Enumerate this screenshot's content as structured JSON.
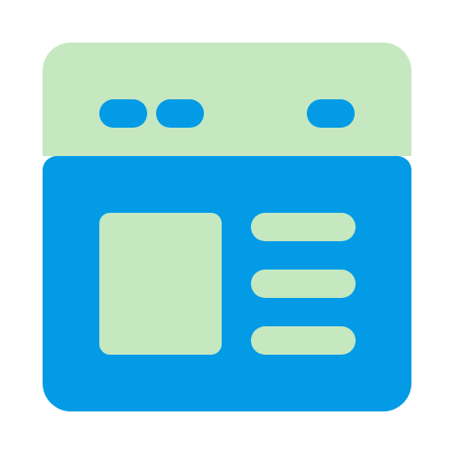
{
  "icon": {
    "name": "browser-window-layout-icon",
    "colors": {
      "frame_light": "#c5e8c1",
      "frame_dark": "#039be5"
    },
    "titlebar": {
      "dots": [
        "window-dot",
        "window-dot",
        "window-dot"
      ]
    },
    "content": {
      "image_placeholder": "image-placeholder",
      "text_lines": [
        "text-line",
        "text-line",
        "text-line"
      ]
    }
  }
}
